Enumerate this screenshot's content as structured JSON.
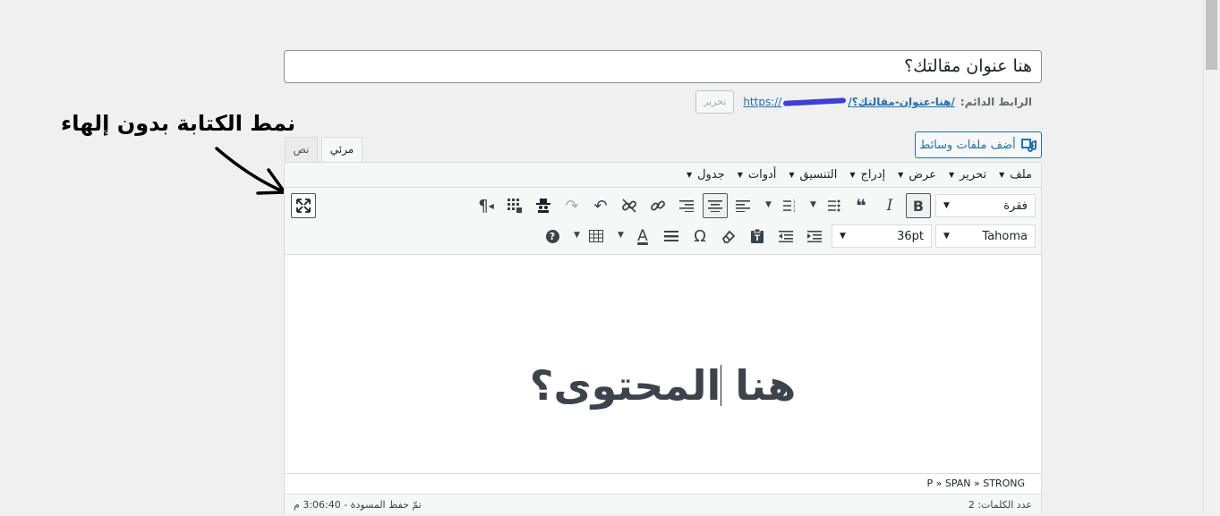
{
  "title_value": "هنا عنوان مقالتك؟",
  "permalink": {
    "label": "الرابط الدائم:",
    "url_prefix": "https://",
    "slug": "/هنا-عنوان-مقالتك؟/",
    "edit_label": "تحرير"
  },
  "annotation": "نمط الكتابة بدون إلهاء",
  "media_button_label": "أضف ملفات وسائط",
  "tabs": {
    "visual": "مرئي",
    "text": "نص"
  },
  "menu": [
    "ملف",
    "تحرير",
    "عرض",
    "إدراج",
    "التنسيق",
    "أدوات",
    "جدول"
  ],
  "toolbar": {
    "format_select": "فقرة",
    "font_family_select": "Tahoma",
    "font_size_select": "36pt",
    "bold": "B",
    "italic": "I",
    "quote": "❝",
    "pilcrow": "¶",
    "omega": "Ω",
    "text_color_letter": "A",
    "help": "?"
  },
  "content_text": "هنا المحتوى؟",
  "path": "P » SPAN » STRONG",
  "status": {
    "word_count": "عدد الكلمات: 2",
    "draft_saved": "تمّ حفظ المسودة - 3:06:40 م"
  },
  "colors": {
    "accent": "#2271b1",
    "background": "#f0f0f1"
  }
}
